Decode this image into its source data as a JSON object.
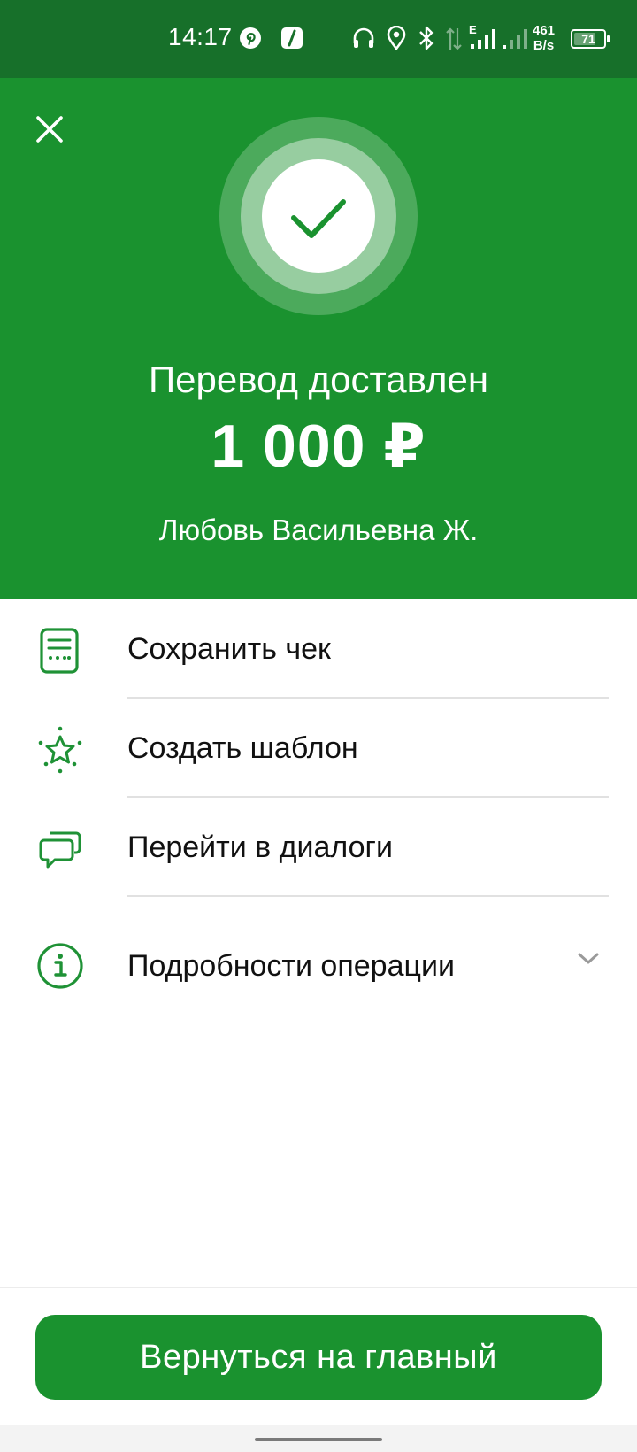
{
  "status_bar": {
    "time": "14:17",
    "network_type": "E",
    "speed_value": "461",
    "speed_unit": "B/s",
    "battery": "71",
    "icons": [
      "pinterest-icon",
      "app-slash-icon",
      "headphones-icon",
      "location-icon",
      "bluetooth-icon",
      "data-arrows-icon",
      "signal-icon",
      "signal-icon-2"
    ]
  },
  "hero": {
    "close_icon": "close-icon",
    "status_icon": "checkmark-icon",
    "title": "Перевод доставлен",
    "amount": "1 000 ₽",
    "recipient": "Любовь Васильевна Ж."
  },
  "actions": [
    {
      "label": "Сохранить чек",
      "icon": "receipt-icon"
    },
    {
      "label": "Создать шаблон",
      "icon": "star-icon"
    },
    {
      "label": "Перейти в диалоги",
      "icon": "chat-icon"
    },
    {
      "label": "Подробности операции",
      "icon": "info-icon"
    }
  ],
  "footer": {
    "main_button": "Вернуться на главный"
  },
  "colors": {
    "status_bar": "#17702a",
    "brand_green": "#1a922f",
    "icon_green": "#1f9236",
    "text": "#111111",
    "divider": "#e1e1e1"
  }
}
